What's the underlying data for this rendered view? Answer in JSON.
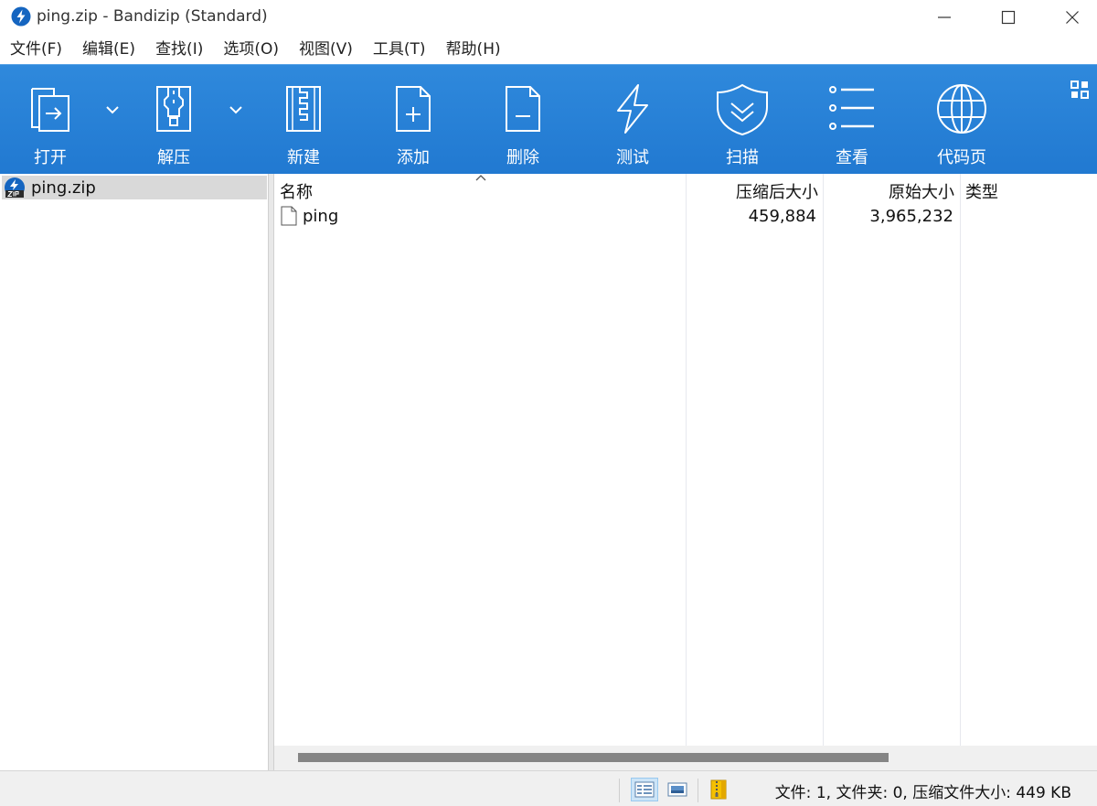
{
  "window": {
    "title": "ping.zip - Bandizip (Standard)"
  },
  "menu": [
    "文件(F)",
    "编辑(E)",
    "查找(I)",
    "选项(O)",
    "视图(V)",
    "工具(T)",
    "帮助(H)"
  ],
  "toolbar": {
    "open": "打开",
    "extract": "解压",
    "new": "新建",
    "add": "添加",
    "delete": "删除",
    "test": "测试",
    "scan": "扫描",
    "view": "查看",
    "codepage": "代码页"
  },
  "tree": {
    "root": "ping.zip"
  },
  "columns": {
    "name": "名称",
    "packed": "压缩后大小",
    "original": "原始大小",
    "type": "类型"
  },
  "files": [
    {
      "name": "ping",
      "packed": "459,884",
      "original": "3,965,232",
      "type": ""
    }
  ],
  "status": {
    "summary": "文件: 1, 文件夹: 0, 压缩文件大小: 449 KB"
  },
  "colors": {
    "toolbar": "#2179d1",
    "accent": "#0a64c8"
  }
}
